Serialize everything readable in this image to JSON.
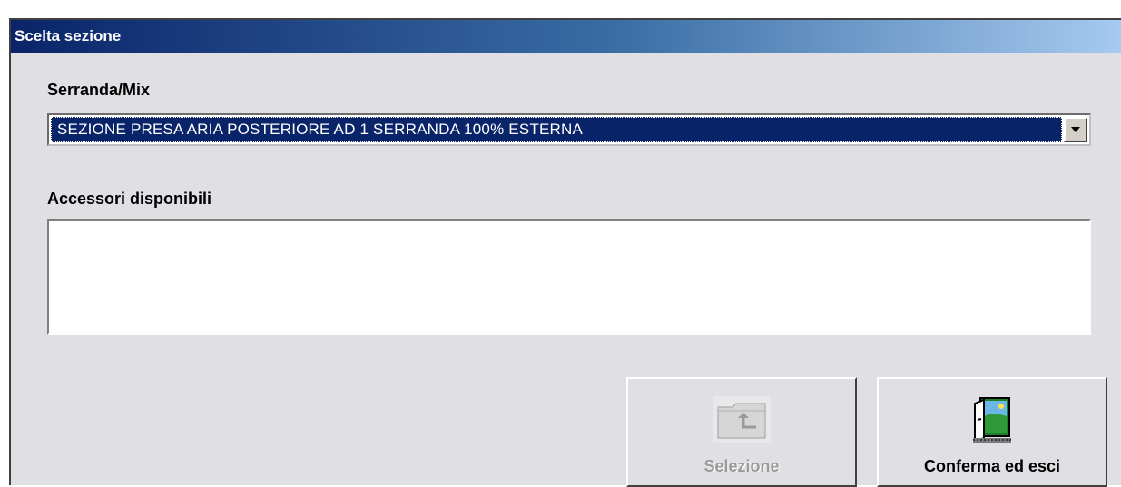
{
  "window": {
    "title": "Scelta sezione"
  },
  "serranda": {
    "label": "Serranda/Mix",
    "selected_value": "SEZIONE PRESA ARIA POSTERIORE AD 1 SERRANDA 100% ESTERNA"
  },
  "accessori": {
    "label": "Accessori disponibili",
    "items": []
  },
  "buttons": {
    "selezione": {
      "label": "Selezione",
      "enabled": false,
      "icon": "folder-up-icon"
    },
    "conferma": {
      "label": "Conferma ed esci",
      "enabled": true,
      "icon": "exit-door-icon"
    }
  },
  "colors": {
    "titlebar_start": "#0a246a",
    "titlebar_end": "#a6caf0",
    "selection": "#0a246a",
    "dialog_bg": "#e0dfe3"
  }
}
